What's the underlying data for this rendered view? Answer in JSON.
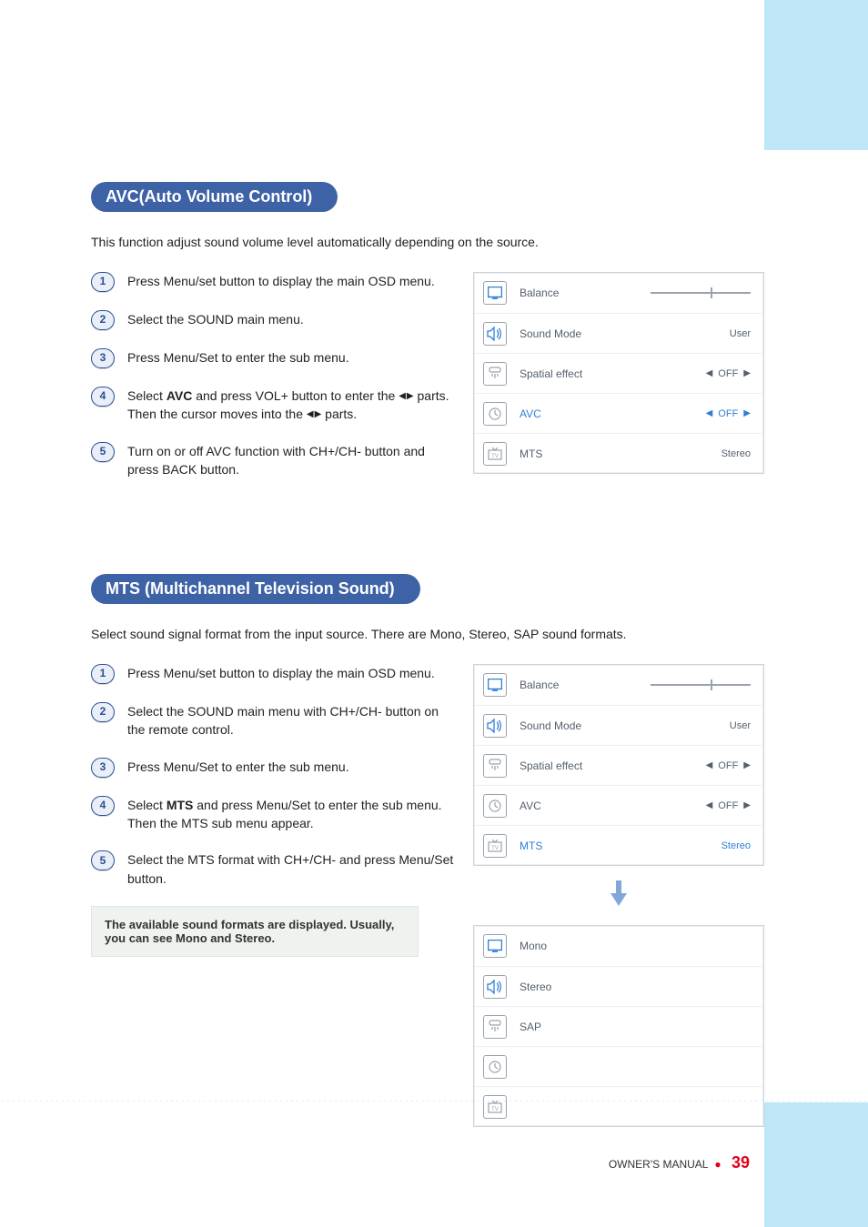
{
  "section_avc": {
    "title": "AVC(Auto Volume Control)",
    "intro": "This function adjust sound volume level automatically depending on the source.",
    "steps": {
      "s1": "Press Menu/set button to display the main OSD menu.",
      "s2": "Select the SOUND main menu.",
      "s3": "Press Menu/Set to enter the sub menu.",
      "s4_pre": "Select ",
      "s4_bold": "AVC",
      "s4_mid": " and press VOL+ button to enter the ",
      "s4_post": " parts. Then the cursor moves into the ",
      "s4_end": " parts.",
      "s5": "Turn on or off AVC function with CH+/CH- button and press BACK button."
    },
    "osd": {
      "balance": {
        "label": "Balance"
      },
      "sound_mode": {
        "label": "Sound Mode",
        "value": "User"
      },
      "spatial": {
        "label": "Spatial effect",
        "value": "OFF"
      },
      "avc": {
        "label": "AVC",
        "value": "OFF"
      },
      "mts": {
        "label": "MTS",
        "value": "Stereo"
      }
    }
  },
  "section_mts": {
    "title": "MTS (Multichannel Television Sound)",
    "intro": "Select sound signal format from the input source. There are Mono, Stereo, SAP sound formats.",
    "steps": {
      "s1": "Press Menu/set button to display the main OSD menu.",
      "s2": "Select the SOUND main menu with CH+/CH- button on the remote control.",
      "s3": "Press Menu/Set to enter the sub menu.",
      "s4_pre": "Select ",
      "s4_bold": "MTS",
      "s4_post": " and press Menu/Set to enter the sub menu. Then the MTS sub menu appear.",
      "s5": "Select the MTS format with CH+/CH- and press Menu/Set button."
    },
    "note": "The available sound formats are displayed. Usually, you can see Mono and Stereo.",
    "osd1": {
      "balance": {
        "label": "Balance"
      },
      "sound_mode": {
        "label": "Sound Mode",
        "value": "User"
      },
      "spatial": {
        "label": "Spatial effect",
        "value": "OFF"
      },
      "avc": {
        "label": "AVC",
        "value": "OFF"
      },
      "mts": {
        "label": "MTS",
        "value": "Stereo"
      }
    },
    "osd2": {
      "mono": "Mono",
      "stereo": "Stereo",
      "sap": "SAP"
    }
  },
  "footer": {
    "label": "OWNER'S MANUAL",
    "page": "39"
  }
}
